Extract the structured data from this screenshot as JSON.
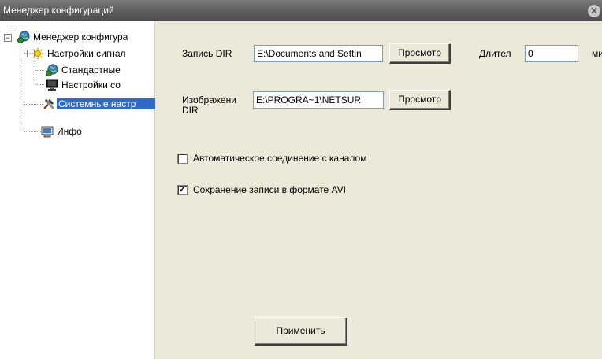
{
  "window": {
    "title": "Менеджер конфигураций"
  },
  "tree": {
    "items": [
      {
        "label": "Менеджер конфигура",
        "icon": "globe-gear-icon"
      },
      {
        "label": "Настройки сигнал",
        "icon": "sun-icon"
      },
      {
        "label": "Стандартные",
        "icon": "globe-icon"
      },
      {
        "label": "Настройки со",
        "icon": "monitor-icon"
      },
      {
        "label": "Системные настр",
        "icon": "tools-icon",
        "selected": true
      },
      {
        "label": "Инфо",
        "icon": "info-computer-icon"
      }
    ]
  },
  "settings": {
    "record_dir_label": "Запись DIR",
    "record_dir_value": "E:\\Documents and Settin",
    "browse_label": "Просмотр",
    "duration_label": "Длител",
    "duration_value": "0",
    "duration_unit": "ми",
    "image_dir_label_line1": "Изображени",
    "image_dir_label_line2": "DIR",
    "image_dir_value": "E:\\PROGRA~1\\NETSUR",
    "auto_connect_label": "Автоматическое соединение с каналом",
    "auto_connect_checked": false,
    "save_avi_label": "Сохранение записи в формате AVI",
    "save_avi_checked": true,
    "apply_label": "Применить"
  }
}
